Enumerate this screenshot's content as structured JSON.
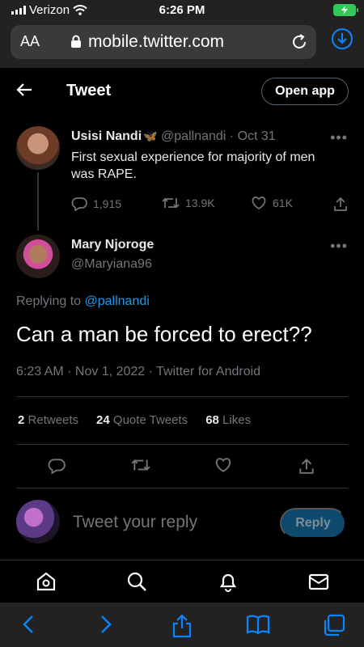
{
  "status": {
    "carrier": "Verizon",
    "time": "6:26 PM"
  },
  "browser": {
    "text_size_label": "AA",
    "url": "mobile.twitter.com"
  },
  "header": {
    "title": "Tweet",
    "open_app": "Open app"
  },
  "parent_tweet": {
    "name": "Usisi Nandi",
    "handle": "@pallnandi",
    "date": "Oct 31",
    "text": "First sexual experience for majority of men was RAPE.",
    "replies": "1,915",
    "retweets": "13.9K",
    "likes": "61K"
  },
  "main_tweet": {
    "name": "Mary Njoroge",
    "handle": "@Maryiana96",
    "replying_prefix": "Replying to",
    "replying_to": "@pallnandi",
    "text": "Can a man be forced to erect??",
    "meta": "6:23 AM · Nov 1, 2022 · Twitter for Android",
    "stats": {
      "retweets_count": "2",
      "retweets_label": "Retweets",
      "quotes_count": "24",
      "quotes_label": "Quote Tweets",
      "likes_count": "68",
      "likes_label": "Likes"
    }
  },
  "reply_box": {
    "placeholder": "Tweet your reply",
    "button": "Reply"
  },
  "icons": {
    "nav": [
      "home-icon",
      "search-icon",
      "bell-icon",
      "mail-icon"
    ],
    "safari": [
      "back-icon",
      "forward-icon",
      "share-icon",
      "bookmarks-icon",
      "tabs-icon"
    ]
  },
  "colors": {
    "accent": "#1d9bf0",
    "battery": "#34c759",
    "reply_button": "#0e4a6e"
  }
}
